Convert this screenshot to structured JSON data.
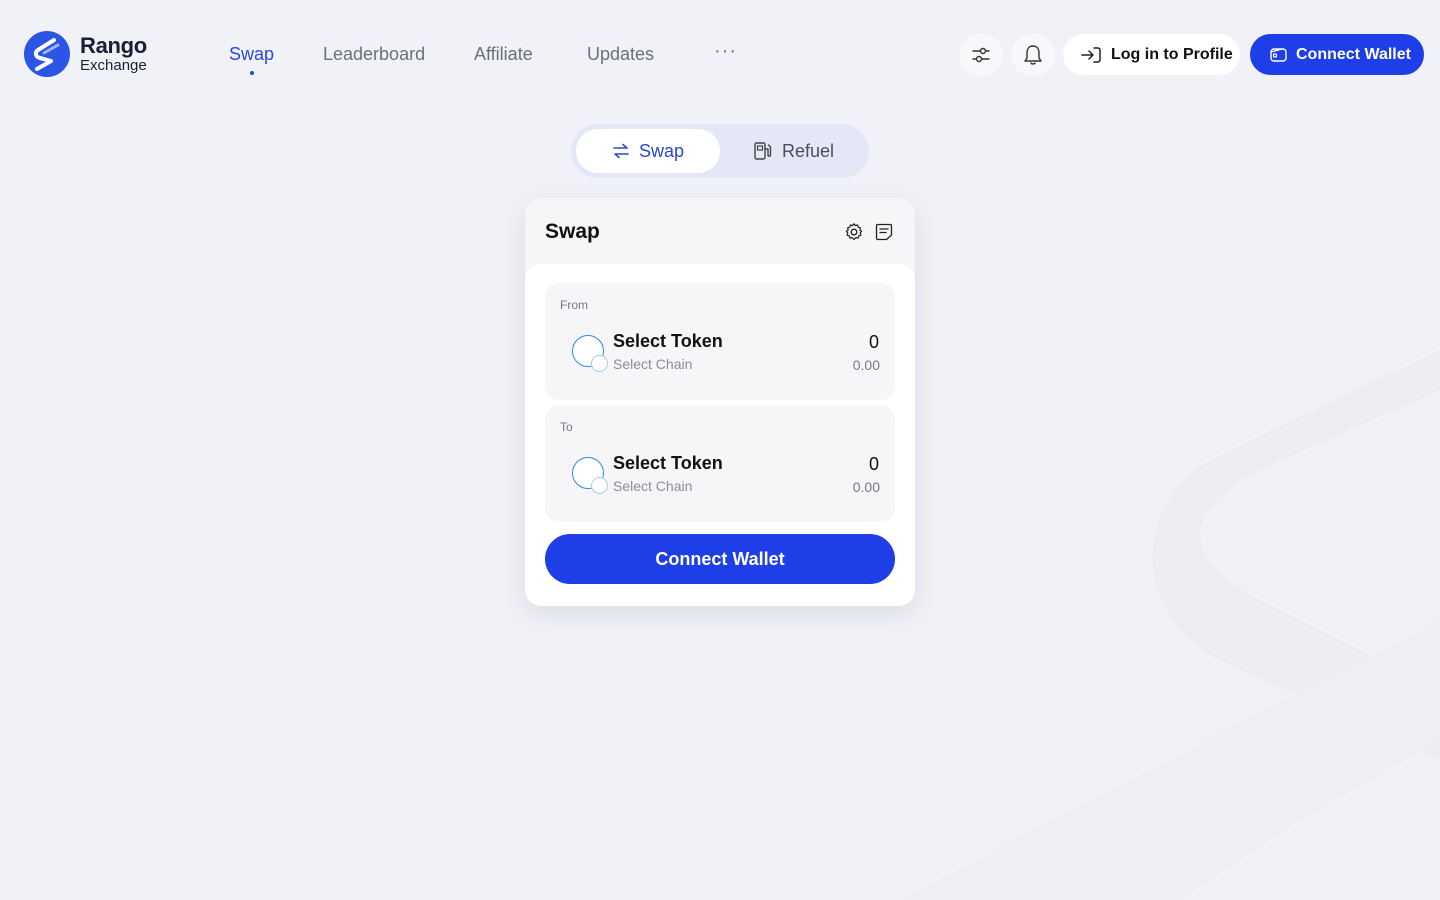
{
  "brand": {
    "name": "Rango",
    "subtitle": "Exchange"
  },
  "nav": {
    "items": [
      {
        "label": "Swap",
        "active": true
      },
      {
        "label": "Leaderboard",
        "active": false
      },
      {
        "label": "Affiliate",
        "active": false
      },
      {
        "label": "Updates",
        "active": false
      }
    ],
    "more_label": "···"
  },
  "header": {
    "settings_icon": "sliders-icon",
    "notifications_icon": "bell-icon",
    "login_label": "Log in to Profile",
    "connect_wallet_label": "Connect Wallet"
  },
  "mode_toggle": {
    "swap_label": "Swap",
    "refuel_label": "Refuel",
    "selected": "Swap"
  },
  "swap_card": {
    "title": "Swap",
    "from": {
      "label": "From",
      "token_placeholder": "Select Token",
      "chain_placeholder": "Select Chain",
      "amount": "0",
      "usd_value": "0.00"
    },
    "to": {
      "label": "To",
      "token_placeholder": "Select Token",
      "chain_placeholder": "Select Chain",
      "amount": "0",
      "usd_value": "0.00"
    },
    "connect_wallet_label": "Connect Wallet"
  },
  "colors": {
    "accent": "#1e3ee8",
    "active_nav": "#2848d8",
    "background": "#f1f2f7",
    "token_ring": "#2f8ae0"
  }
}
